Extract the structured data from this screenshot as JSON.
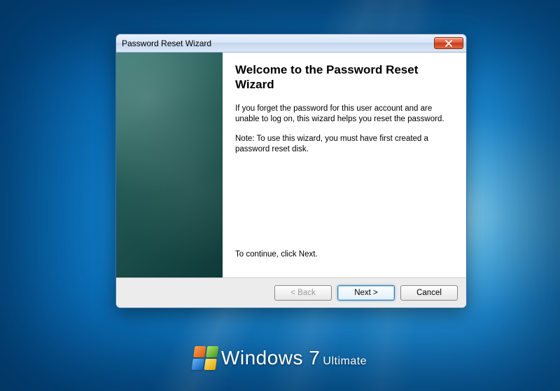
{
  "os": {
    "brand_prefix": "Windows",
    "brand_version": "7",
    "brand_edition": "Ultimate"
  },
  "dialog": {
    "title": "Password Reset Wizard",
    "heading": "Welcome to the Password Reset Wizard",
    "paragraph1": "If you forget the password for this user account and are unable to log on, this wizard helps you reset the password.",
    "paragraph2": "Note: To use this wizard, you must have first created a password reset disk.",
    "continue_text": "To continue, click Next.",
    "buttons": {
      "back": "< Back",
      "next": "Next >",
      "cancel": "Cancel"
    }
  },
  "icons": {
    "close": "close-icon"
  }
}
